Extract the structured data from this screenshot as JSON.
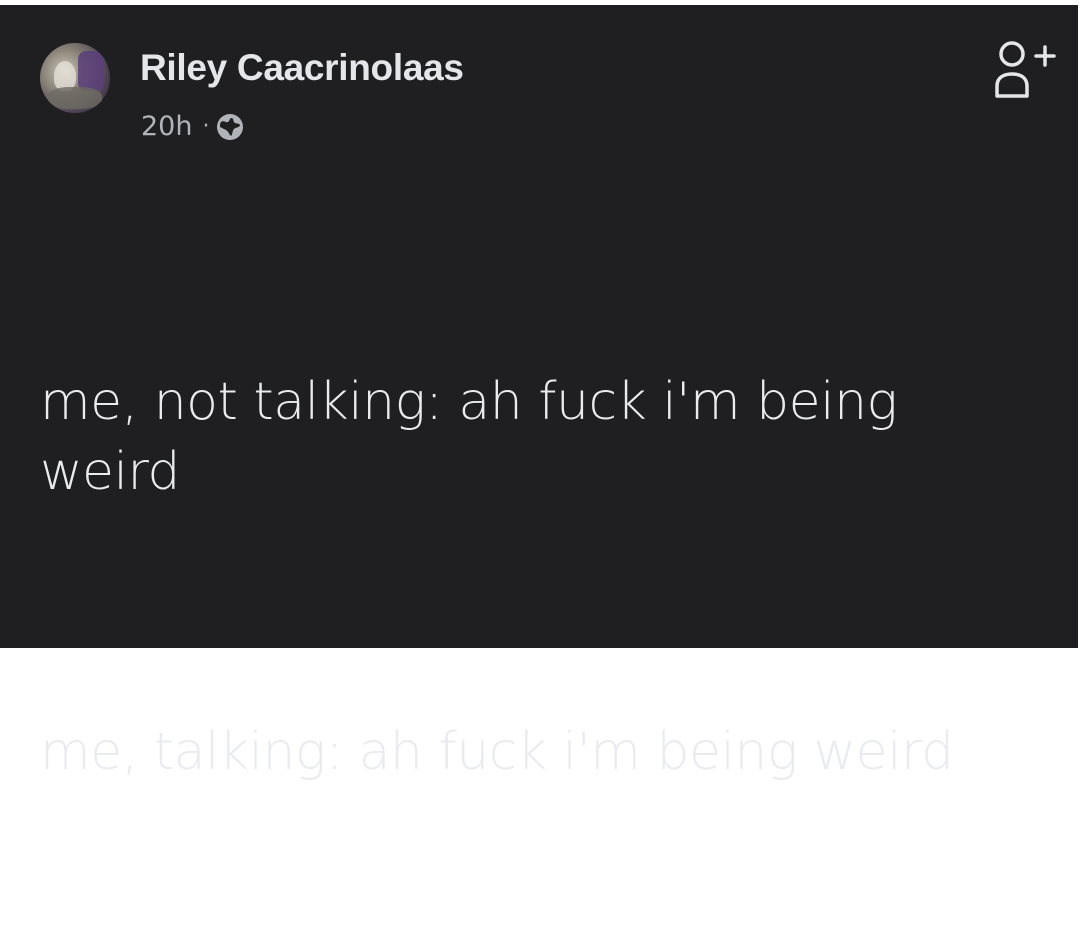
{
  "post": {
    "author": "Riley Caacrinolaas",
    "timestamp": "20h",
    "separator": "·",
    "visibility_icon": "globe-icon",
    "action_icon": "add-friend-icon",
    "paragraphs": [
      "me, not talking: ah fuck i'm being weird",
      "me, talking: ah fuck i'm being weird"
    ]
  },
  "colors": {
    "background": "#1f1f21",
    "primary_text": "#e4e6ea",
    "secondary_text": "#b0b3b8"
  }
}
